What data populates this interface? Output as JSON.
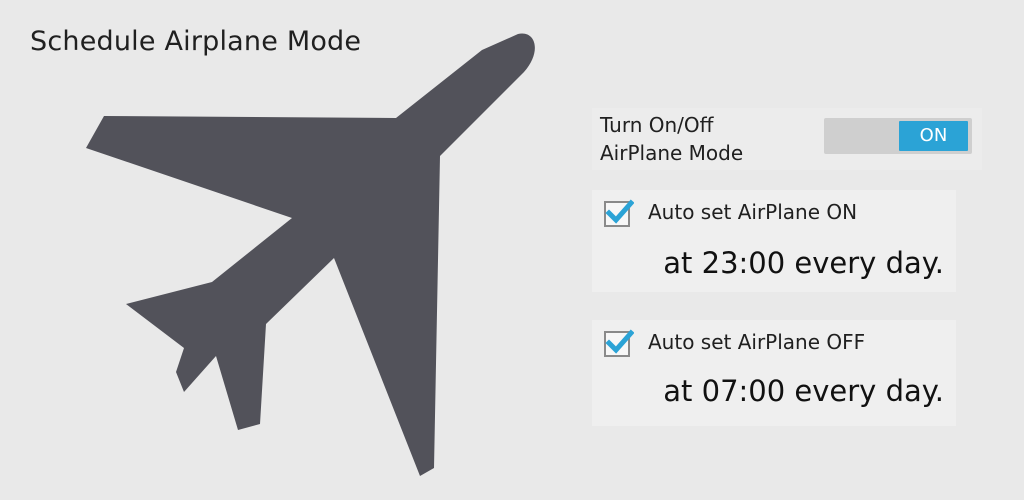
{
  "app": {
    "title": "Schedule Airplane Mode"
  },
  "toggle": {
    "label_line1": "Turn On/Off",
    "label_line2": "AirPlane Mode",
    "state": "ON",
    "accent": "#2ba3d6"
  },
  "schedules": [
    {
      "checked": true,
      "label": "Auto set AirPlane ON",
      "time_text": "at 23:00 every day."
    },
    {
      "checked": true,
      "label": "Auto set AirPlane OFF",
      "time_text": "at 07:00 every day."
    }
  ],
  "icons": {
    "hero": "airplane-icon",
    "check": "checkmark-icon"
  },
  "colors": {
    "icon": "#52525a",
    "background": "#e9e9e9"
  }
}
